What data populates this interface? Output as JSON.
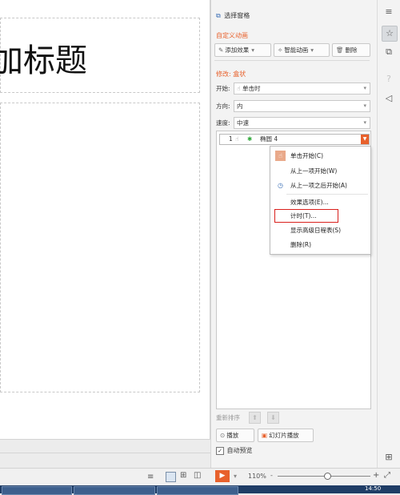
{
  "slide": {
    "title_text": "加标题"
  },
  "panel": {
    "selection_pane_label": "选择窗格",
    "custom_anim_title": "自定义动画",
    "add_effect_label": "添加效果",
    "smart_anim_label": "智能动画",
    "delete_label": "删除",
    "modify_title": "修改: 盒状",
    "start_label": "开始:",
    "start_value": "单击时",
    "direction_label": "方向:",
    "direction_value": "内",
    "speed_label": "速度:",
    "speed_value": "中速",
    "anim_item": {
      "index": "1",
      "name": "椭圆 4"
    },
    "reorder_label": "重新排序",
    "play_label": "播放",
    "slideshow_label": "幻灯片播放",
    "auto_preview_label": "自动预览",
    "auto_preview_checked": true
  },
  "context_menu": {
    "items": [
      {
        "label": "单击开始(C)",
        "icon": "mouse-click-icon"
      },
      {
        "label": "从上一项开始(W)",
        "icon": ""
      },
      {
        "label": "从上一项之后开始(A)",
        "icon": "clock-icon"
      },
      {
        "label": "效果选项(E)...",
        "icon": ""
      },
      {
        "label": "计时(T)...",
        "icon": ""
      },
      {
        "label": "显示高级日程表(S)",
        "icon": ""
      },
      {
        "label": "删除(R)",
        "icon": ""
      }
    ],
    "highlighted": "计时(T)..."
  },
  "statusbar": {
    "zoom_label": "110%"
  },
  "taskbar": {
    "clock": "14:50"
  },
  "colors": {
    "accent": "#e8612c",
    "highlight": "#d9201c"
  }
}
